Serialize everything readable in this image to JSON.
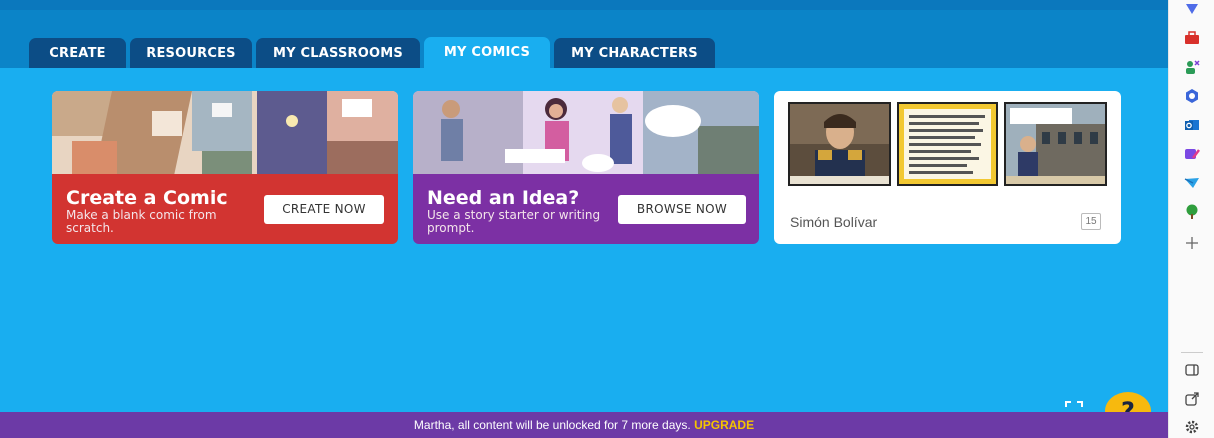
{
  "tabs": [
    {
      "label": "CREATE"
    },
    {
      "label": "RESOURCES"
    },
    {
      "label": "MY CLASSROOMS"
    },
    {
      "label": "MY COMICS",
      "active": true
    },
    {
      "label": "MY CHARACTERS"
    }
  ],
  "cards": {
    "create": {
      "title": "Create a Comic",
      "subtitle": "Make a blank comic from scratch.",
      "button": "CREATE NOW"
    },
    "idea": {
      "title": "Need an Idea?",
      "subtitle": "Use a story starter or writing prompt.",
      "button": "BROWSE NOW"
    },
    "comic": {
      "title": "Simón Bolívar",
      "page_count": "15"
    }
  },
  "banner": {
    "message": "Martha, all content will be unlocked for 7 more days.",
    "upgrade": "UPGRADE"
  },
  "help": {
    "label": "?"
  },
  "colors": {
    "main_bg": "#19aef0",
    "tab_bg": "#0c4d86",
    "card_red": "#d23431",
    "card_purple": "#7c30a4",
    "banner_bg": "#6c3aa6",
    "upgrade": "#f5c400",
    "help_bg": "#f7b90e"
  },
  "sidebar_icons": [
    "diamond-icon",
    "briefcase-icon",
    "people-icon",
    "office-icon",
    "outlook-icon",
    "brush-icon",
    "send-icon",
    "tree-icon",
    "plus-icon",
    "sidebar-panel-icon",
    "open-external-icon",
    "settings-icon"
  ]
}
